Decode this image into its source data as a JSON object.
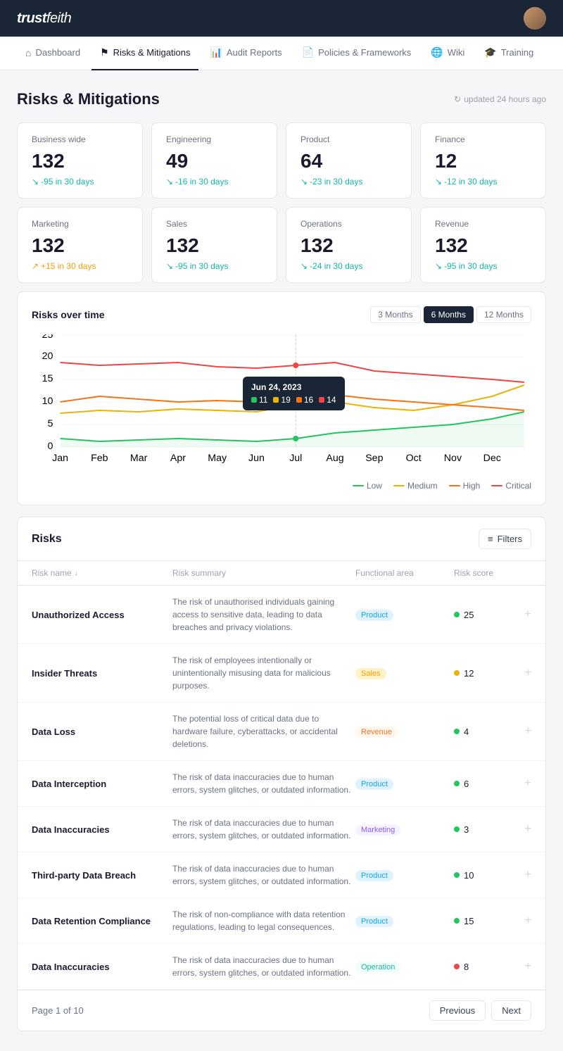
{
  "header": {
    "logo": "trust",
    "logo_italic": "feith"
  },
  "nav": {
    "items": [
      {
        "id": "dashboard",
        "label": "Dashboard",
        "icon": "⌂",
        "active": false
      },
      {
        "id": "risks",
        "label": "Risks & Mitigations",
        "icon": "⚑",
        "active": true
      },
      {
        "id": "audit",
        "label": "Audit Reports",
        "icon": "📊",
        "active": false
      },
      {
        "id": "policies",
        "label": "Policies & Frameworks",
        "icon": "📄",
        "active": false
      },
      {
        "id": "wiki",
        "label": "Wiki",
        "icon": "🌐",
        "active": false
      },
      {
        "id": "training",
        "label": "Training",
        "icon": "🎓",
        "active": false
      }
    ]
  },
  "page": {
    "title": "Risks & Mitigations",
    "updated": "updated 24 hours ago"
  },
  "summary_cards": [
    {
      "label": "Business wide",
      "value": "132",
      "change": "-95 in 30 days",
      "direction": "down"
    },
    {
      "label": "Engineering",
      "value": "49",
      "change": "-16 in 30 days",
      "direction": "down"
    },
    {
      "label": "Product",
      "value": "64",
      "change": "-23 in 30 days",
      "direction": "down"
    },
    {
      "label": "Finance",
      "value": "12",
      "change": "-12 in 30 days",
      "direction": "down"
    },
    {
      "label": "Marketing",
      "value": "132",
      "change": "+15 in 30 days",
      "direction": "up"
    },
    {
      "label": "Sales",
      "value": "132",
      "change": "-95 in 30 days",
      "direction": "down"
    },
    {
      "label": "Operations",
      "value": "132",
      "change": "-24 in 30 days",
      "direction": "down"
    },
    {
      "label": "Revenue",
      "value": "132",
      "change": "-95 in 30 days",
      "direction": "down"
    }
  ],
  "chart": {
    "title": "Risks over time",
    "buttons": [
      "3 Months",
      "6 Months",
      "12 Months"
    ],
    "active_button": "6 Months",
    "x_labels": [
      "Jan",
      "Feb",
      "Mar",
      "Apr",
      "May",
      "Jun",
      "Jul",
      "Aug",
      "Sep",
      "Oct",
      "Nov",
      "Dec"
    ],
    "y_labels": [
      "0",
      "5",
      "10",
      "15",
      "20",
      "25"
    ],
    "tooltip": {
      "date": "Jun 24, 2023",
      "values": [
        {
          "color": "#22c55e",
          "value": "11"
        },
        {
          "color": "#eab308",
          "value": "19"
        },
        {
          "color": "#f97316",
          "value": "16"
        },
        {
          "color": "#ef4444",
          "value": "14"
        }
      ]
    },
    "legend": [
      {
        "label": "Low",
        "color": "#22c55e"
      },
      {
        "label": "Medium",
        "color": "#eab308"
      },
      {
        "label": "High",
        "color": "#f97316"
      },
      {
        "label": "Critical",
        "color": "#ef4444"
      }
    ]
  },
  "risks": {
    "title": "Risks",
    "filter_label": "Filters",
    "columns": [
      "Risk name",
      "Risk summary",
      "Functional area",
      "Risk score"
    ],
    "rows": [
      {
        "name": "Unauthorized Access",
        "summary": "The risk of unauthorised individuals gaining access to sensitive data, leading to data breaches and privacy violations.",
        "area": "Product",
        "area_class": "badge-product",
        "score": 25,
        "score_class": "score-green"
      },
      {
        "name": "Insider Threats",
        "summary": "The risk of employees intentionally or unintentionally misusing data for malicious purposes.",
        "area": "Sales",
        "area_class": "badge-sales",
        "score": 12,
        "score_class": "score-yellow"
      },
      {
        "name": "Data Loss",
        "summary": "The potential loss of critical data due to hardware failure, cyberattacks, or accidental deletions.",
        "area": "Revenue",
        "area_class": "badge-revenue",
        "score": 4,
        "score_class": "score-green"
      },
      {
        "name": "Data Interception",
        "summary": "The risk of data inaccuracies due to human errors, system glitches, or outdated information.",
        "area": "Product",
        "area_class": "badge-product",
        "score": 6,
        "score_class": "score-green"
      },
      {
        "name": "Data Inaccuracies",
        "summary": "The risk of data inaccuracies due to human errors, system glitches, or outdated information.",
        "area": "Marketing",
        "area_class": "badge-marketing",
        "score": 3,
        "score_class": "score-green"
      },
      {
        "name": "Third-party Data Breach",
        "summary": "The risk of data inaccuracies due to human errors, system glitches, or outdated information.",
        "area": "Product",
        "area_class": "badge-product",
        "score": 10,
        "score_class": "score-green"
      },
      {
        "name": "Data Retention Compliance",
        "summary": "The risk of non-compliance with data retention regulations, leading to legal consequences.",
        "area": "Product",
        "area_class": "badge-product",
        "score": 15,
        "score_class": "score-green"
      },
      {
        "name": "Data Inaccuracies",
        "summary": "The risk of data inaccuracies due to human errors, system glitches, or outdated information.",
        "area": "Operation",
        "area_class": "badge-operation",
        "score": 8,
        "score_class": "score-red"
      }
    ]
  },
  "pagination": {
    "page_info": "Page 1 of 10",
    "previous": "Previous",
    "next": "Next"
  }
}
